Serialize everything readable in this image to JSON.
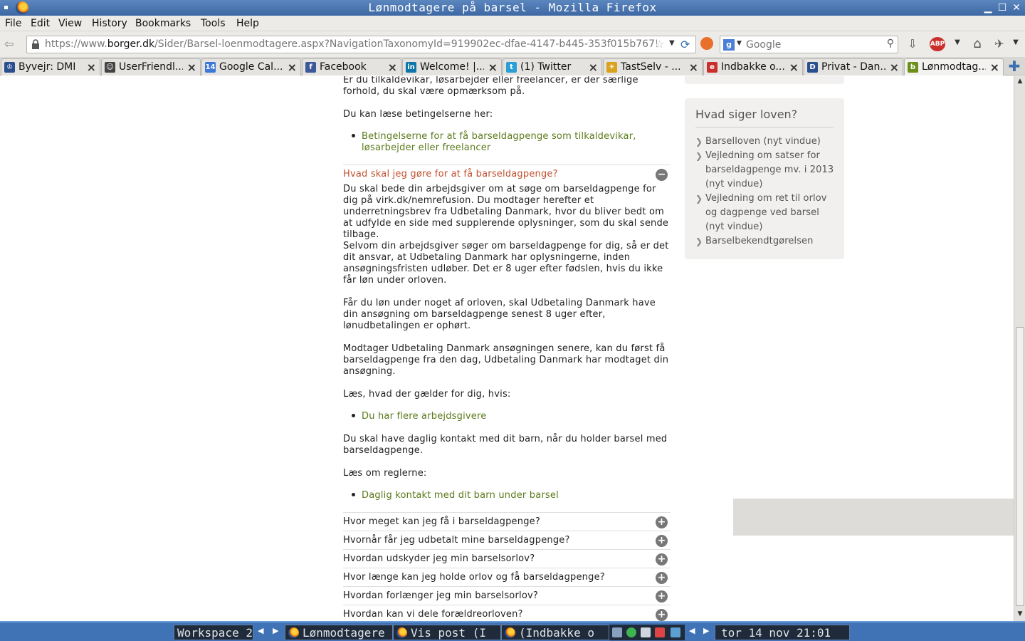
{
  "window": {
    "title": "Lønmodtagere på barsel - Mozilla Firefox"
  },
  "menu": [
    "File",
    "Edit",
    "View",
    "History",
    "Bookmarks",
    "Tools",
    "Help"
  ],
  "nav": {
    "url_prefix": "https://www.",
    "url_domain": "borger.dk",
    "url_rest": "/Sider/Barsel-loenmodtagere.aspx?NavigationTaxonomyId=919902ec-dfae-4147-b445-353f015b767!",
    "search_placeholder": "Google"
  },
  "tabs": [
    {
      "label": "Byvejr: DMI",
      "icon_color": "#2a4f8f",
      "glyph": "♔"
    },
    {
      "label": "UserFriendl...",
      "icon_color": "#444444",
      "glyph": "☺"
    },
    {
      "label": "Google Cal...",
      "icon_color": "#3b78d8",
      "glyph": "14"
    },
    {
      "label": "Facebook",
      "icon_color": "#3b5998",
      "glyph": "f"
    },
    {
      "label": "Welcome! |...",
      "icon_color": "#0e76a8",
      "glyph": "in"
    },
    {
      "label": "(1) Twitter",
      "icon_color": "#2a9fd6",
      "glyph": "t"
    },
    {
      "label": "TastSelv - ...",
      "icon_color": "#d9a21b",
      "glyph": "☀"
    },
    {
      "label": "Indbakke o...",
      "icon_color": "#c9302c",
      "glyph": "e"
    },
    {
      "label": "Privat - Dan...",
      "icon_color": "#2a4f8f",
      "glyph": "D"
    },
    {
      "label": "Lønmodtag...",
      "icon_color": "#6a8f1a",
      "glyph": "b"
    }
  ],
  "content": {
    "p1": "Er du tilkaldevikar, løsarbejder eller freelancer, er der særlige forhold, du skal være opmærksom på.",
    "p2": "Du kan læse betingelserne her:",
    "link1": "Betingelserne for at få barseldagpenge som tilkaldevikar, løsarbejder eller freelancer",
    "open_question": "Hvad skal jeg gøre for at få barseldagpenge?",
    "p3": "Du skal bede din arbejdsgiver om at søge om barseldagpenge for dig på virk.dk/nemrefusion. Du modtager herefter et underretningsbrev fra Udbetaling Danmark, hvor du bliver bedt om at udfylde en side med supplerende oplysninger, som du skal sende tilbage.",
    "p4": "Selvom din arbejdsgiver søger om barseldagpenge for dig, så er det dit ansvar, at Udbetaling Danmark har oplysningerne, inden ansøgningsfristen udløber. Det er 8 uger efter fødslen, hvis du ikke får løn under orloven.",
    "p5": "Får du løn under noget af orloven, skal Udbetaling Danmark have din ansøgning om barseldagpenge senest 8 uger efter, lønudbetalingen er ophørt.",
    "p6": "Modtager Udbetaling Danmark ansøgningen senere, kan du først få barseldagpenge fra den dag, Udbetaling Danmark har modtaget din ansøgning.",
    "p7": "Læs, hvad der gælder for dig, hvis:",
    "link2": "Du har flere arbejdsgivere",
    "p8": "Du skal have daglig kontakt med dit barn, når du holder barsel med barseldagpenge.",
    "p9": "Læs om reglerne:",
    "link3": "Daglig kontakt med dit barn under barsel",
    "questions": [
      "Hvor meget kan jeg få i barseldagpenge?",
      "Hvornår får jeg udbetalt mine barseldagpenge?",
      "Hvordan udskyder jeg min barselsorlov?",
      "Hvor længe kan jeg holde orlov og få barseldagpenge?",
      "Hvordan forlænger jeg min barselsorlov?",
      "Hvordan kan vi dele forældreorloven?"
    ]
  },
  "sidebar": {
    "heading": "Hvad siger loven?",
    "links": [
      "Barselloven (nyt vindue)",
      "Vejledning om satser for barseldagpenge mv. i 2013 (nyt vindue)",
      "Vejledning om ret til orlov og dagpenge ved barsel (nyt vindue)",
      "Barselbekendtgørelsen"
    ]
  },
  "taskbar": {
    "workspace": "Workspace 2",
    "windows": [
      "Lønmodtagere",
      "Vis post (I",
      "(Indbakke o"
    ],
    "clock": "tor 14 nov 21:01"
  }
}
